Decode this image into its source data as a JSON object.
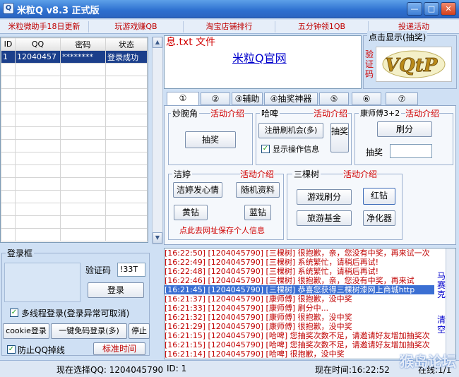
{
  "window": {
    "title": "米粒Q v8.3 正式版",
    "logo": "Q",
    "minimize": "—",
    "maximize": "□",
    "close": "✕"
  },
  "toplinks": [
    "米粒微助手18日更新",
    "玩游戏赚QB",
    "淘宝店铺排行",
    "五分钟领1QB",
    "投递活动"
  ],
  "accounts": {
    "headers": [
      "ID",
      "QQ",
      "密码",
      "状态"
    ],
    "rows": [
      [
        "1",
        "12040457",
        "********",
        "登录成功"
      ]
    ]
  },
  "login": {
    "group_label": "登录框",
    "captcha_label": "验证码",
    "captcha_value": "!33T",
    "login_button": "登录",
    "multi_thread_label": "多线程登录(登录异常可取消)",
    "cookie_button": "cookie登录",
    "free_login_button": "一键免码登录(多)",
    "stop_button": "停止",
    "anti_drop_label": "防止QQ掉线",
    "standard_time_button": "标准时间"
  },
  "web": {
    "partial_text": "息.txt 文件",
    "link": "米粒Q官网"
  },
  "captcha": {
    "group_label": "点击显示(抽奖)",
    "side_label": "验证码",
    "image_text": "VQtP"
  },
  "tabs": [
    "①",
    "②",
    "③辅助",
    "④抽奖神器",
    "⑤",
    "⑥",
    "⑦"
  ],
  "panel": {
    "miaowanjiao": {
      "title": "妙腕角",
      "intro": "活动介绍",
      "lottery": "抽奖"
    },
    "haha": {
      "title": "哈啤",
      "intro": "活动介绍",
      "register": "注册刷机会(多)",
      "lottery": "抽奖",
      "show_info": "显示操作信息"
    },
    "kangshifu": {
      "title": "康师傅3+2",
      "intro": "活动介绍",
      "refresh": "刷分",
      "lottery_label": "抽奖"
    },
    "jieting": {
      "title": "洁婷",
      "intro": "活动介绍",
      "heart": "洁婷发心情",
      "random": "随机资料",
      "yellow": "黄钻",
      "blue": "蓝钻",
      "save_link": "点此去网址保存个人信息"
    },
    "sankeshu": {
      "title": "三棵树",
      "intro": "活动介绍",
      "game": "游戏刷分",
      "red": "红钻",
      "travel": "旅游基金",
      "purify": "净化器"
    }
  },
  "log": {
    "lines": [
      "[16:22:50] [1204045790] [三棵树] 很抱歉，亲，您没有中奖，再来试一次",
      "[16:22:49] [1204045790] [三棵树] 系统繁忙，请稍后再试!",
      "[16:22:48] [1204045790] [三棵树] 系统繁忙，请稍后再试!",
      "[16:22:46] [1204045790] [三棵树] 很抱歉，亲，您没有中奖，再来试",
      "[16:21:45] [1204045790] [三棵树] 恭喜您获得三棵树漆网上商城http",
      "[16:21:37] [1204045790] [康师傅] 很抱歉，没中奖",
      "[16:21:33] [1204045790] [康师傅] 刷分中...",
      "[16:21:32] [1204045790] [康师傅] 很抱歉，没中奖",
      "[16:21:29] [1204045790] [康师傅] 很抱歉，没中奖",
      "[16:21:15] [1204045790] [哈啤] 您抽奖次数不足，请邀请好友增加抽奖次",
      "[16:21:15] [1204045790] [哈啤] 您抽奖次数不足，请邀请好友增加抽奖次",
      "[16:21:14] [1204045790] [哈啤] 很抱歉，没中奖"
    ],
    "highlight_index": 4,
    "side_text_1": "马",
    "side_text_2": "赛",
    "side_text_3": "克",
    "side_text_4": "清",
    "side_text_5": "空"
  },
  "status": {
    "current_qq": "现在选择QQ: 1204045790",
    "id": "ID: 1",
    "time": "现在时间:16:22:52",
    "online": "在线:1/1"
  },
  "watermark": "猴岛论坛"
}
